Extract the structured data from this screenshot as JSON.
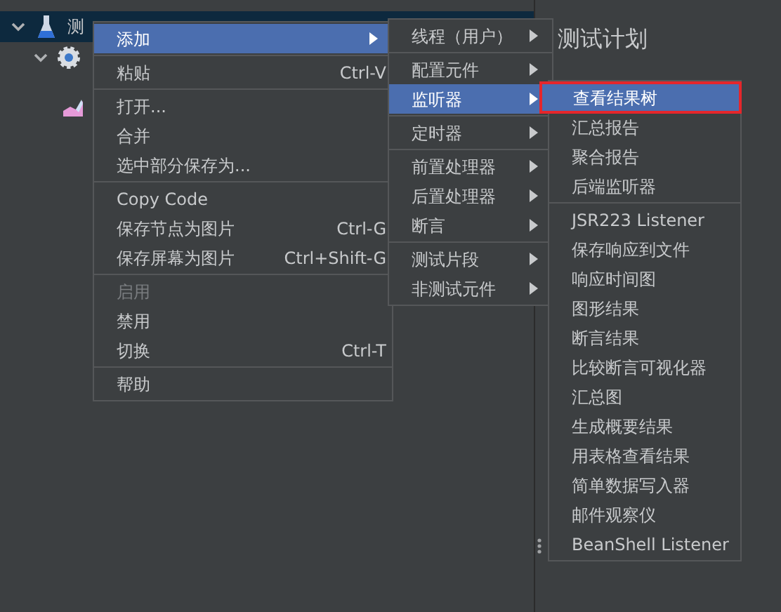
{
  "tree": {
    "items": [
      {
        "label": "测",
        "selected": true,
        "expanded": true,
        "children": [
          {
            "selected": false,
            "expanded": true
          },
          {
            "selected": false
          }
        ]
      }
    ]
  },
  "panel": {
    "title": "测试计划"
  },
  "menus": [
    {
      "groups": [
        [
          {
            "label": "添加",
            "submenu": true,
            "selected": true,
            "disabled": false
          }
        ],
        [
          {
            "label": "粘贴",
            "shortcut": "Ctrl-V",
            "submenu": false,
            "selected": false,
            "disabled": false
          }
        ],
        [
          {
            "label": "打开...",
            "submenu": false,
            "selected": false,
            "disabled": false
          },
          {
            "label": "合并",
            "submenu": false,
            "selected": false,
            "disabled": false
          },
          {
            "label": "选中部分保存为...",
            "submenu": false,
            "selected": false,
            "disabled": false
          }
        ],
        [
          {
            "label": "Copy Code",
            "submenu": false,
            "selected": false,
            "disabled": false
          },
          {
            "label": "保存节点为图片",
            "shortcut": "Ctrl-G",
            "submenu": false,
            "selected": false,
            "disabled": false
          },
          {
            "label": "保存屏幕为图片",
            "shortcut": "Ctrl+Shift-G",
            "submenu": false,
            "selected": false,
            "disabled": false
          }
        ],
        [
          {
            "label": "启用",
            "submenu": false,
            "selected": false,
            "disabled": true
          },
          {
            "label": "禁用",
            "submenu": false,
            "selected": false,
            "disabled": false
          },
          {
            "label": "切换",
            "shortcut": "Ctrl-T",
            "submenu": false,
            "selected": false,
            "disabled": false
          }
        ],
        [
          {
            "label": "帮助",
            "submenu": false,
            "selected": false,
            "disabled": false
          }
        ]
      ]
    },
    {
      "groups": [
        [
          {
            "label": "线程（用户）",
            "submenu": true,
            "selected": false
          }
        ],
        [
          {
            "label": "配置元件",
            "submenu": true,
            "selected": false
          },
          {
            "label": "监听器",
            "submenu": true,
            "selected": true
          }
        ],
        [
          {
            "label": "定时器",
            "submenu": true,
            "selected": false
          }
        ],
        [
          {
            "label": "前置处理器",
            "submenu": true,
            "selected": false
          },
          {
            "label": "后置处理器",
            "submenu": true,
            "selected": false
          },
          {
            "label": "断言",
            "submenu": true,
            "selected": false
          }
        ],
        [
          {
            "label": "测试片段",
            "submenu": true,
            "selected": false
          },
          {
            "label": "非测试元件",
            "submenu": true,
            "selected": false
          }
        ]
      ]
    },
    {
      "groups": [
        [
          {
            "label": "查看结果树",
            "selected": true,
            "highlighted": true
          },
          {
            "label": "汇总报告",
            "selected": false,
            "highlighted": false
          },
          {
            "label": "聚合报告",
            "selected": false,
            "highlighted": false
          },
          {
            "label": "后端监听器",
            "selected": false,
            "highlighted": false
          }
        ],
        [
          {
            "label": "JSR223 Listener",
            "selected": false,
            "highlighted": false
          },
          {
            "label": "保存响应到文件",
            "selected": false,
            "highlighted": false
          },
          {
            "label": "响应时间图",
            "selected": false,
            "highlighted": false
          },
          {
            "label": "图形结果",
            "selected": false,
            "highlighted": false
          },
          {
            "label": "断言结果",
            "selected": false,
            "highlighted": false
          },
          {
            "label": "比较断言可视化器",
            "selected": false,
            "highlighted": false
          },
          {
            "label": "汇总图",
            "selected": false,
            "highlighted": false
          },
          {
            "label": "生成概要结果",
            "selected": false,
            "highlighted": false
          },
          {
            "label": "用表格查看结果",
            "selected": false,
            "highlighted": false
          },
          {
            "label": "简单数据写入器",
            "selected": false,
            "highlighted": false
          },
          {
            "label": "邮件观察仪",
            "selected": false,
            "highlighted": false
          },
          {
            "label": "BeanShell Listener",
            "selected": false,
            "highlighted": false
          }
        ]
      ]
    }
  ]
}
